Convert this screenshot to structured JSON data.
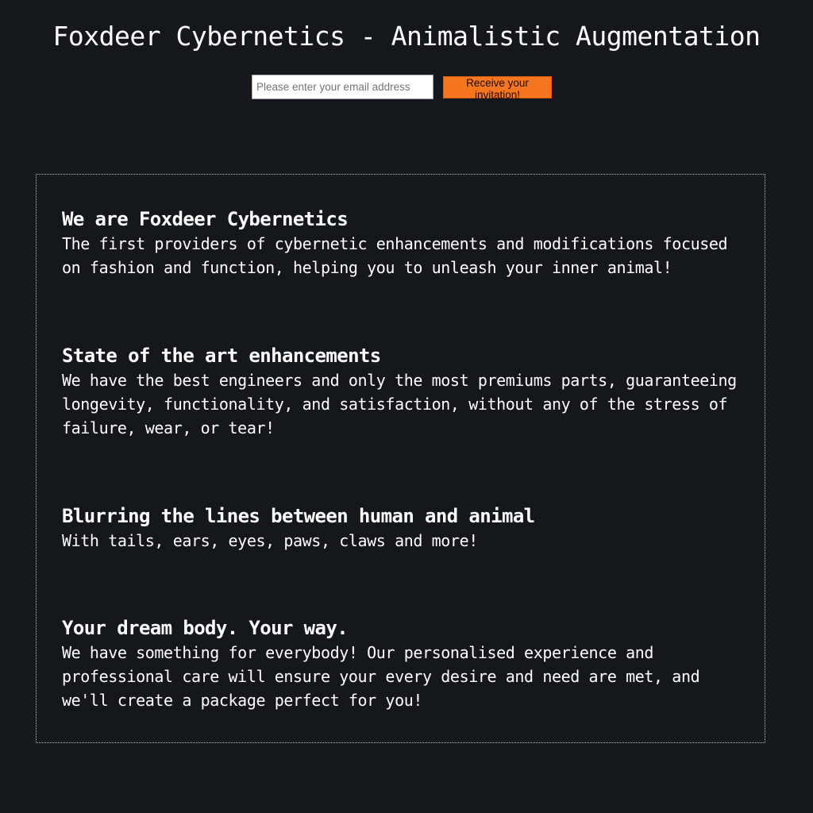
{
  "header": {
    "title": "Foxdeer Cybernetics - Animalistic Augmentation"
  },
  "signup": {
    "email_placeholder": "Please enter your email address",
    "email_value": "",
    "button_label": "Receive your invitation!"
  },
  "colors": {
    "background": "#14171c",
    "accent": "#f6761f",
    "text": "#ffffff"
  },
  "features": [
    {
      "heading": "We are Foxdeer Cybernetics",
      "text": "The first providers of cybernetic enhancements and modifications focused on fashion and function, helping you to unleash your inner animal!"
    },
    {
      "heading": "State of the art enhancements",
      "text": "We have the best engineers and only the most premiums parts, guaranteeing longevity, functionality, and satisfaction, without any of the stress of failure, wear, or tear!"
    },
    {
      "heading": "Blurring the lines between human and animal",
      "text": "With tails, ears, eyes, paws, claws and more!"
    },
    {
      "heading": "Your dream body. Your way.",
      "text": "We have something for everybody! Our personalised experience and professional care will ensure your every desire and need are met, and we'll create a package perfect for you!"
    }
  ]
}
